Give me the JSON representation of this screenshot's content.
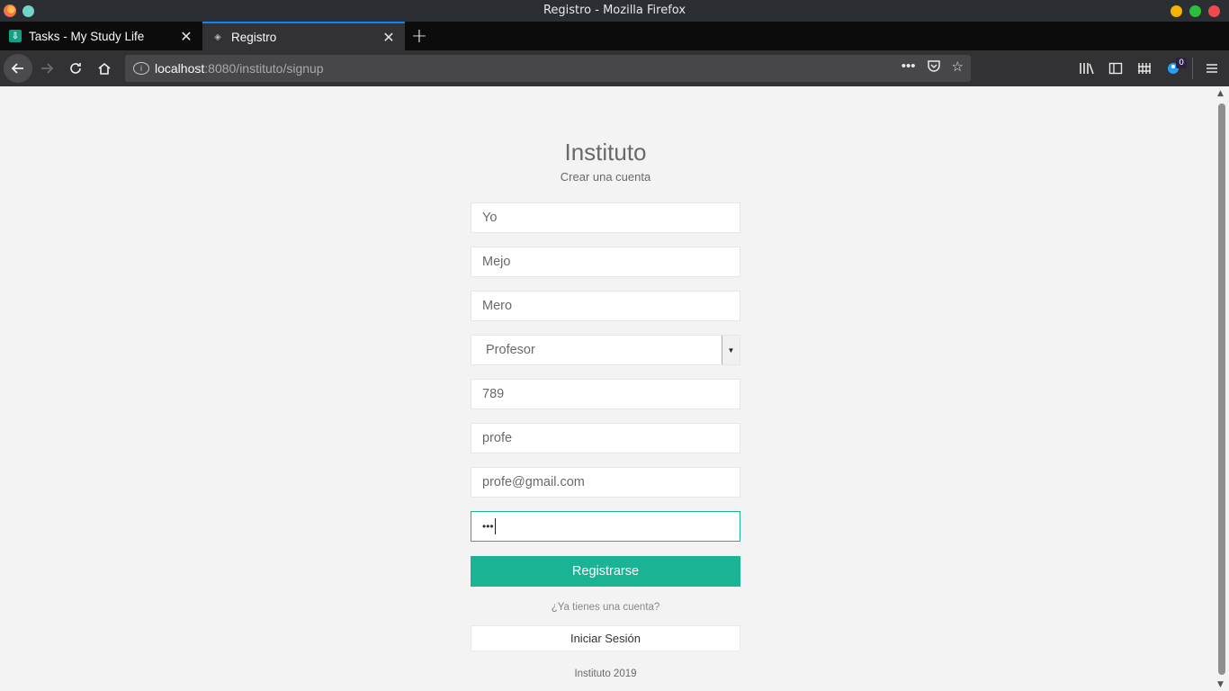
{
  "window": {
    "title": "Registro - Mozilla Firefox",
    "controls": {
      "minimize_color": "#f5b400",
      "maximize_color": "#2ebd3c",
      "close_color": "#f04a50"
    }
  },
  "tabs": [
    {
      "label": "Tasks - My Study Life",
      "active": false
    },
    {
      "label": "Registro",
      "active": true
    }
  ],
  "url": {
    "host": "localhost",
    "path": ":8080/instituto/signup"
  },
  "toolbar": {
    "notification_count": "0"
  },
  "page": {
    "brand": "Instituto",
    "subtitle": "Crear una cuenta",
    "fields": {
      "nombre": "Yo",
      "apellido_paterno": "Mejo",
      "apellido_materno": "Mero",
      "tipo_usuario": "Profesor",
      "numero": "789",
      "usuario": "profe",
      "email": "profe@gmail.com",
      "password_mask": "•••"
    },
    "register_button": "Registrarse",
    "question": "¿Ya tienes una cuenta?",
    "login_button": "Iniciar Sesión",
    "footer": "Instituto 2019"
  },
  "colors": {
    "accent": "#1ab394",
    "tab_highlight": "#0a84ff"
  }
}
